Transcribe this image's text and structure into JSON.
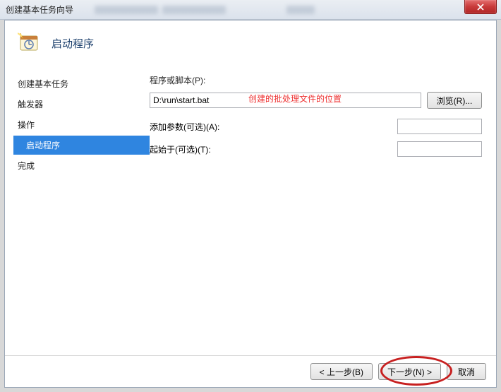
{
  "titlebar": {
    "title": "创建基本任务向导"
  },
  "header": {
    "title": "启动程序"
  },
  "sidebar": {
    "items": [
      {
        "label": "创建基本任务"
      },
      {
        "label": "触发器"
      },
      {
        "label": "操作"
      },
      {
        "label": "启动程序"
      },
      {
        "label": "完成"
      }
    ]
  },
  "form": {
    "program_label": "程序或脚本(P):",
    "program_value": "D:\\run\\start.bat",
    "browse_label": "浏览(R)...",
    "args_label": "添加参数(可选)(A):",
    "args_value": "",
    "startin_label": "起始于(可选)(T):",
    "startin_value": ""
  },
  "annotation": {
    "program_note": "创建的批处理文件的位置"
  },
  "footer": {
    "back": "< 上一步(B)",
    "next": "下一步(N) >",
    "cancel": "取消"
  }
}
